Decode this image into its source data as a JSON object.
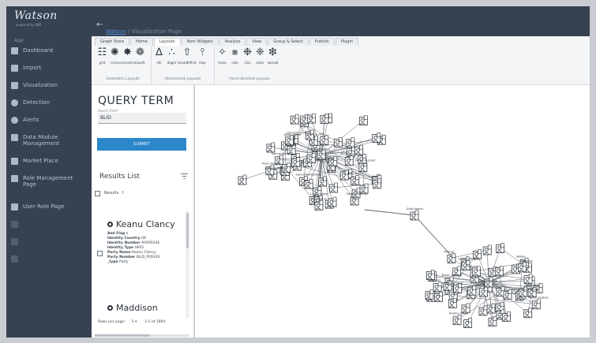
{
  "app": {
    "brand": "Watson",
    "brand_sub": "powered by IBM"
  },
  "sidebar": {
    "section_label": "App",
    "items": [
      {
        "label": "Dashboard",
        "icon": "dashboard-icon"
      },
      {
        "label": "Import",
        "icon": "import-icon"
      },
      {
        "label": "Visualization",
        "icon": "visualization-icon"
      },
      {
        "label": "Detection",
        "icon": "detection-icon"
      },
      {
        "label": "Alerts",
        "icon": "alert-icon"
      },
      {
        "label": "Data Module Management",
        "icon": "data-module-icon"
      },
      {
        "label": "Market Place",
        "icon": "market-place-icon"
      },
      {
        "label": "Role Management Page",
        "icon": "role-management-icon"
      },
      {
        "label": "User Role Page",
        "icon": "user-role-icon"
      }
    ]
  },
  "breadcrumb": {
    "root": "Watson",
    "separator": "/",
    "current": "Visualization Page"
  },
  "ribbon": {
    "tabs": [
      "Graph Store",
      "Home",
      "Layouts",
      "Item Widgets",
      "Analyse",
      "View",
      "Group & Select",
      "Publish",
      "Plugin"
    ],
    "active_tab": "Layouts",
    "groups": [
      {
        "label": "Geometric Layouts",
        "tools": [
          {
            "label": "grid",
            "glyph": "☷"
          },
          {
            "label": "circle",
            "glyph": "✺"
          },
          {
            "label": "concentric",
            "glyph": "✸"
          },
          {
            "label": "cosoft",
            "glyph": "❁"
          }
        ]
      },
      {
        "label": "Hierarchical Layouts",
        "tools": [
          {
            "label": "elk",
            "glyph": "∆"
          },
          {
            "label": "dagre",
            "glyph": "∴"
          },
          {
            "label": "breadthfirst",
            "glyph": "⇧"
          },
          {
            "label": "klay",
            "glyph": "⫯"
          }
        ]
      },
      {
        "label": "Force-directed Layouts",
        "tools": [
          {
            "label": "fcose",
            "glyph": "✧"
          },
          {
            "label": "cola",
            "glyph": "⨳"
          },
          {
            "label": "cise",
            "glyph": "❉"
          },
          {
            "label": "euler",
            "glyph": "❈"
          },
          {
            "label": "spread",
            "glyph": "❇"
          }
        ]
      }
    ]
  },
  "query": {
    "title": "QUERY TERM",
    "search_label": "Search field*",
    "search_value": "BLID",
    "submit_label": "SUBMIT"
  },
  "results": {
    "title": "Results List",
    "header_label": "Results",
    "cards": [
      {
        "name": "Keanu Clancy",
        "lines": [
          {
            "k": "Aml Flag",
            "v": "n"
          },
          {
            "k": "Identity Country",
            "v": "HK"
          },
          {
            "k": "Identity Number",
            "v": "A0000246"
          },
          {
            "k": "Identity Type",
            "v": "HKID"
          },
          {
            "k": "Party Name",
            "v": "Keanu Clancy"
          },
          {
            "k": "Party Number",
            "v": "BLID_P00246"
          },
          {
            "k": "_type",
            "v": "Party"
          }
        ]
      },
      {
        "name": "Maddison"
      }
    ],
    "rows_per_page_label": "Rows per page:",
    "rows_per_page_value": "5",
    "range": "1-5 of 1894"
  },
  "graph": {
    "cluster_a_labels": [
      "Samuel James",
      "Adam Cooke",
      "Lorum Fuller",
      "Anna Ruiz",
      "Kathy Hamilton",
      "Gallus Rowlandson",
      "Cameron Smith",
      "Dennis Bennet",
      "Antonio Mcleod",
      "Lucy Ludwig",
      "Chris Rooney",
      "Ivan Cronin",
      "Paulo Amaro",
      "Rodriguez",
      "Mitchell"
    ],
    "cluster_b_labels": [
      "Alexandra Anderson",
      "Daniel Davis",
      "Thaddeus Blanc",
      "Brooks Cohen",
      "Hailey Hughes",
      "Emily Vera",
      "Trevor Graham",
      "Anderson",
      "Harmon",
      "Thomas",
      "Lorenzo Wright",
      "Walker",
      "Sullivan",
      "Garcia"
    ],
    "bridge_label": "Scott Moore"
  }
}
